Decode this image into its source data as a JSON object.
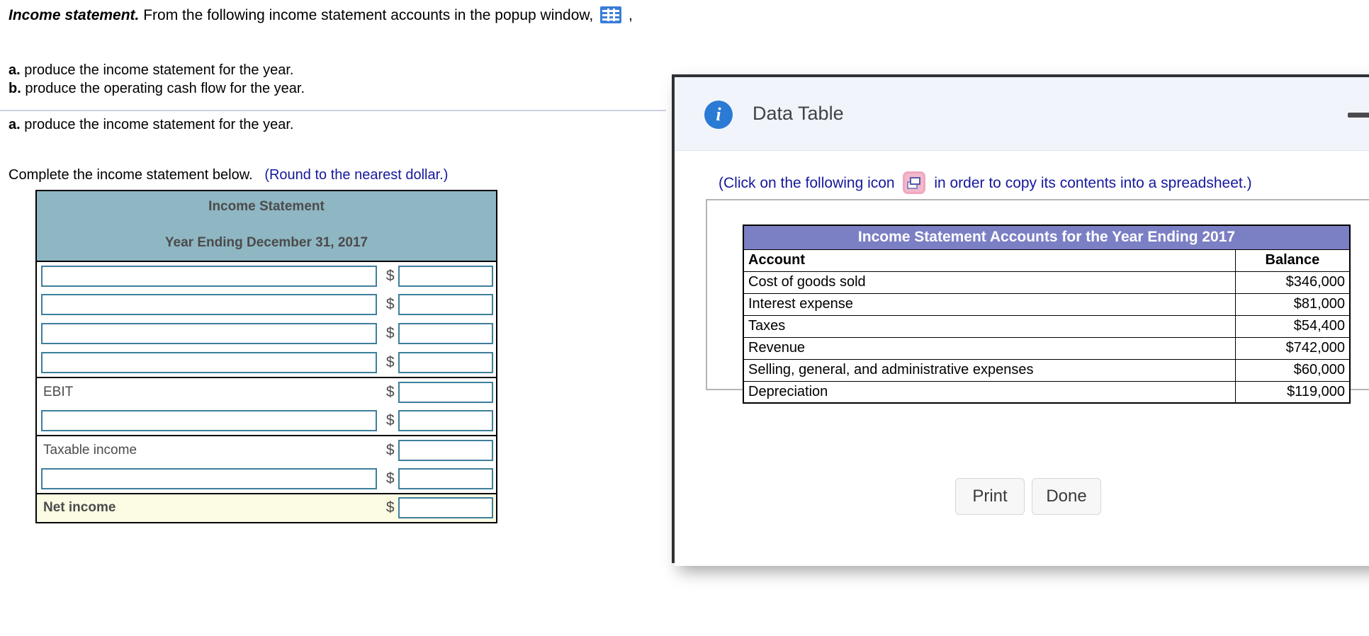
{
  "problem": {
    "lead": "Income statement.",
    "intro": "From the following income statement accounts in the popup window,",
    "trailing_comma": ",",
    "grid_icon": "grid-table-icon",
    "parts": [
      {
        "marker": "a.",
        "text": "produce the income statement for the year."
      },
      {
        "marker": "b.",
        "text": "produce the operating cash flow for the year."
      }
    ],
    "active_part": {
      "marker": "a.",
      "text": "produce the income statement for the year."
    },
    "complete_text": "Complete the income statement below.",
    "rounding_hint": "(Round to the nearest dollar.)"
  },
  "income_statement": {
    "title_line1": "Income Statement",
    "title_line2": "Year Ending December 31, 2017",
    "dollar_sign": "$",
    "rows": [
      {
        "label": "",
        "input": true,
        "value": ""
      },
      {
        "label": "",
        "input": true,
        "value": ""
      },
      {
        "label": "",
        "input": true,
        "value": ""
      },
      {
        "label": "",
        "input": true,
        "value": ""
      },
      {
        "label": "EBIT",
        "input": false,
        "value": ""
      },
      {
        "label": "",
        "input": true,
        "value": ""
      },
      {
        "label": "Taxable income",
        "input": false,
        "value": ""
      },
      {
        "label": "",
        "input": true,
        "value": ""
      },
      {
        "label": "Net income",
        "input": false,
        "value": ""
      }
    ]
  },
  "dialog": {
    "title": "Data Table",
    "info_icon": "info-icon",
    "minimize_label": "minimize",
    "copy_note_before": "(Click on the following icon",
    "copy_icon": "copy-to-spreadsheet-icon",
    "copy_note_after": "in order to copy its contents into a spreadsheet.)",
    "buttons": [
      {
        "label": "Print"
      },
      {
        "label": "Done"
      }
    ],
    "table": {
      "title": "Income Statement Accounts for the Year Ending 2017",
      "columns": [
        "Account",
        "Balance"
      ],
      "rows": [
        {
          "account": "Cost of goods sold",
          "balance": "$346,000"
        },
        {
          "account": "Interest expense",
          "balance": "$81,000"
        },
        {
          "account": "Taxes",
          "balance": "$54,400"
        },
        {
          "account": "Revenue",
          "balance": "$742,000"
        },
        {
          "account": "Selling, general, and administrative expenses",
          "balance": "$60,000"
        },
        {
          "account": "Depreciation",
          "balance": "$119,000"
        }
      ]
    }
  },
  "colors": {
    "is_header_bg": "#8fb6c3",
    "net_income_bg": "#fcfbe3",
    "input_border": "#3d7f9b",
    "dt_header_bg": "#7b7fc4",
    "hint_blue": "#16189c",
    "info_blue": "#2b7ad4"
  }
}
